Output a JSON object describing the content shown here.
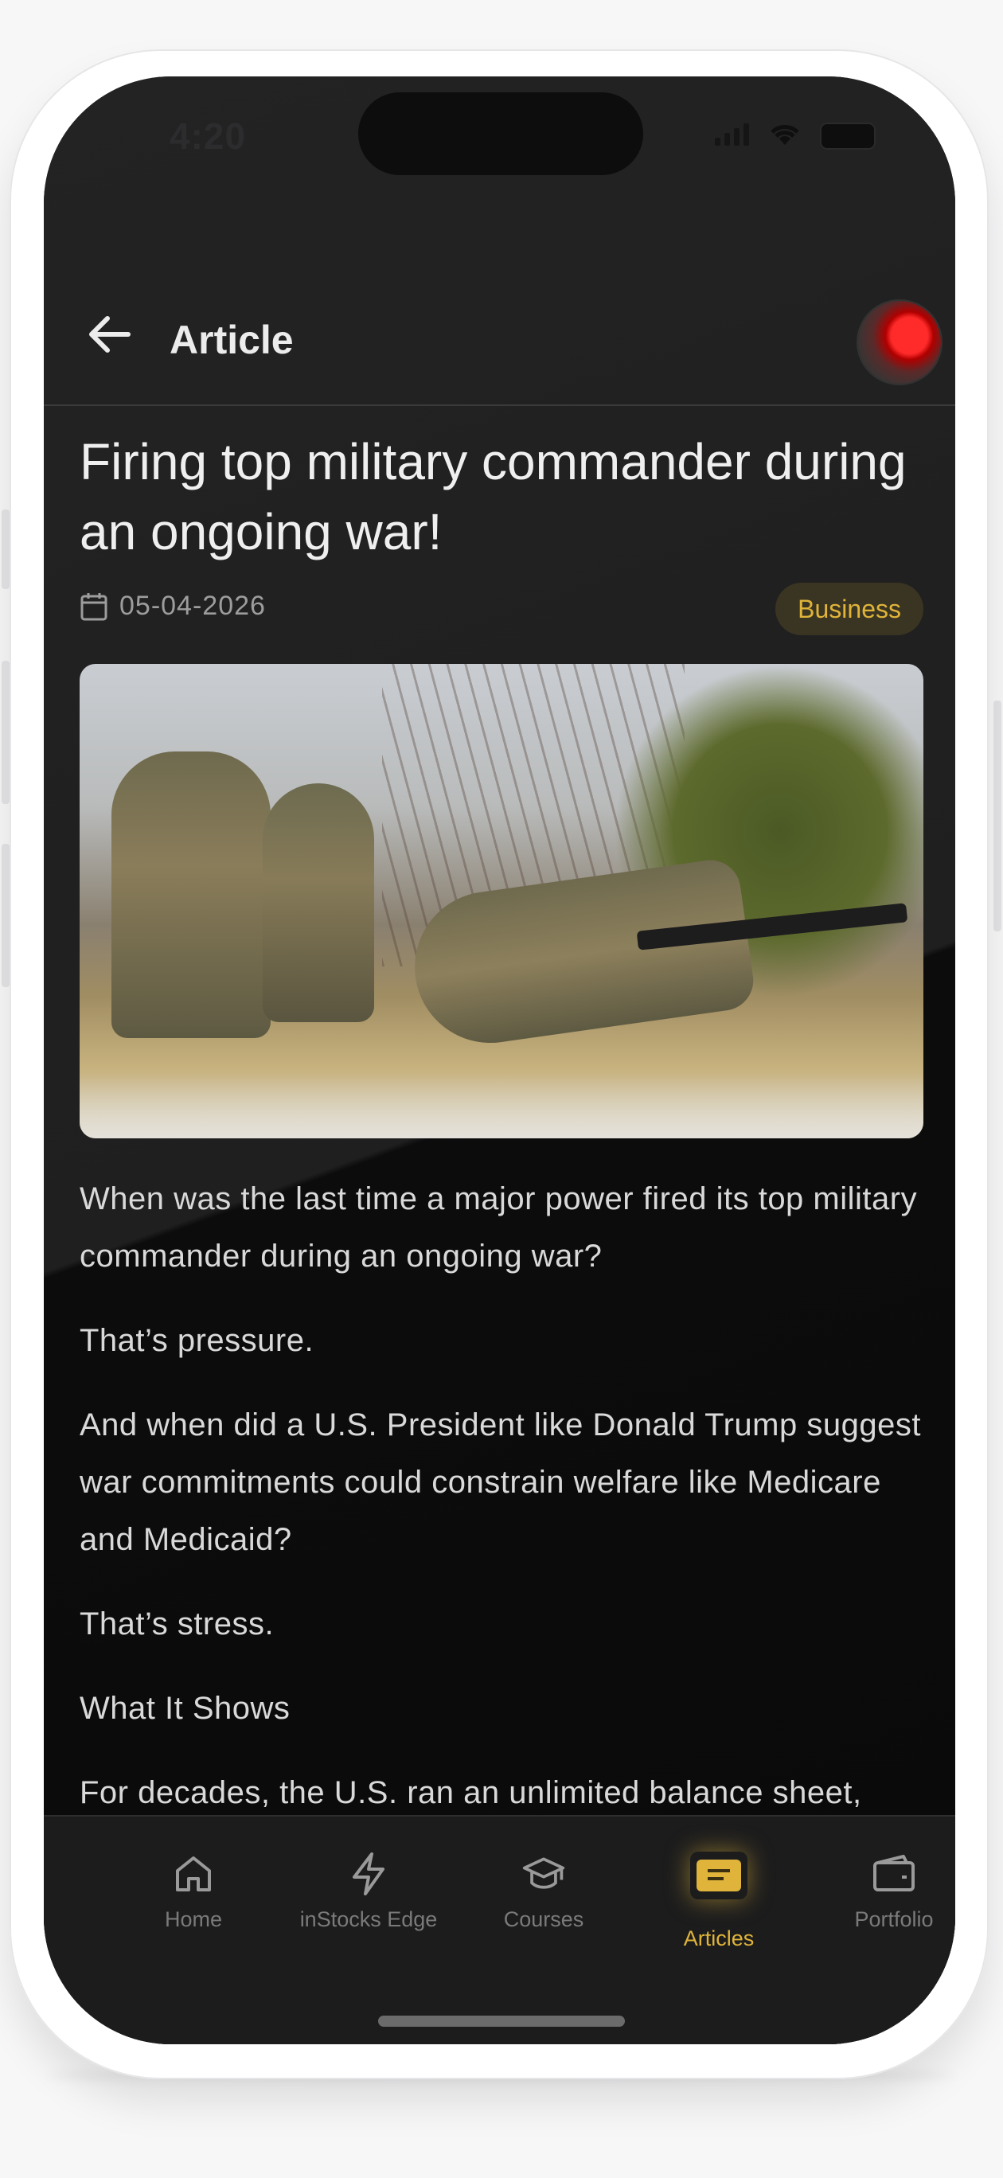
{
  "status_bar": {
    "time": "4:20"
  },
  "header": {
    "title": "Article"
  },
  "article": {
    "title": "Firing top military commander during an ongoing war!",
    "date": "05-04-2026",
    "category": "Business",
    "paragraphs": [
      "When was the last time a major power fired its top military commander during an ongoing war?",
      "That’s pressure.",
      "And when did a U.S. President like Donald Trump suggest war commitments could constrain welfare like Medicare and Medicaid?",
      "That’s stress.",
      "What It Shows",
      "For decades, the U.S. ran an unlimited balance sheet, backed by dollar dominance."
    ]
  },
  "bottom_nav": {
    "items": [
      {
        "label": "Home",
        "icon": "home-icon"
      },
      {
        "label": "inStocks Edge",
        "icon": "lightning-icon"
      },
      {
        "label": "Courses",
        "icon": "graduation-cap-icon"
      },
      {
        "label": "Articles",
        "icon": "articles-icon",
        "active": true
      },
      {
        "label": "Portfolio",
        "icon": "wallet-icon"
      }
    ]
  },
  "colors": {
    "accent": "#e0b43a",
    "background": "#1f1f1f"
  }
}
